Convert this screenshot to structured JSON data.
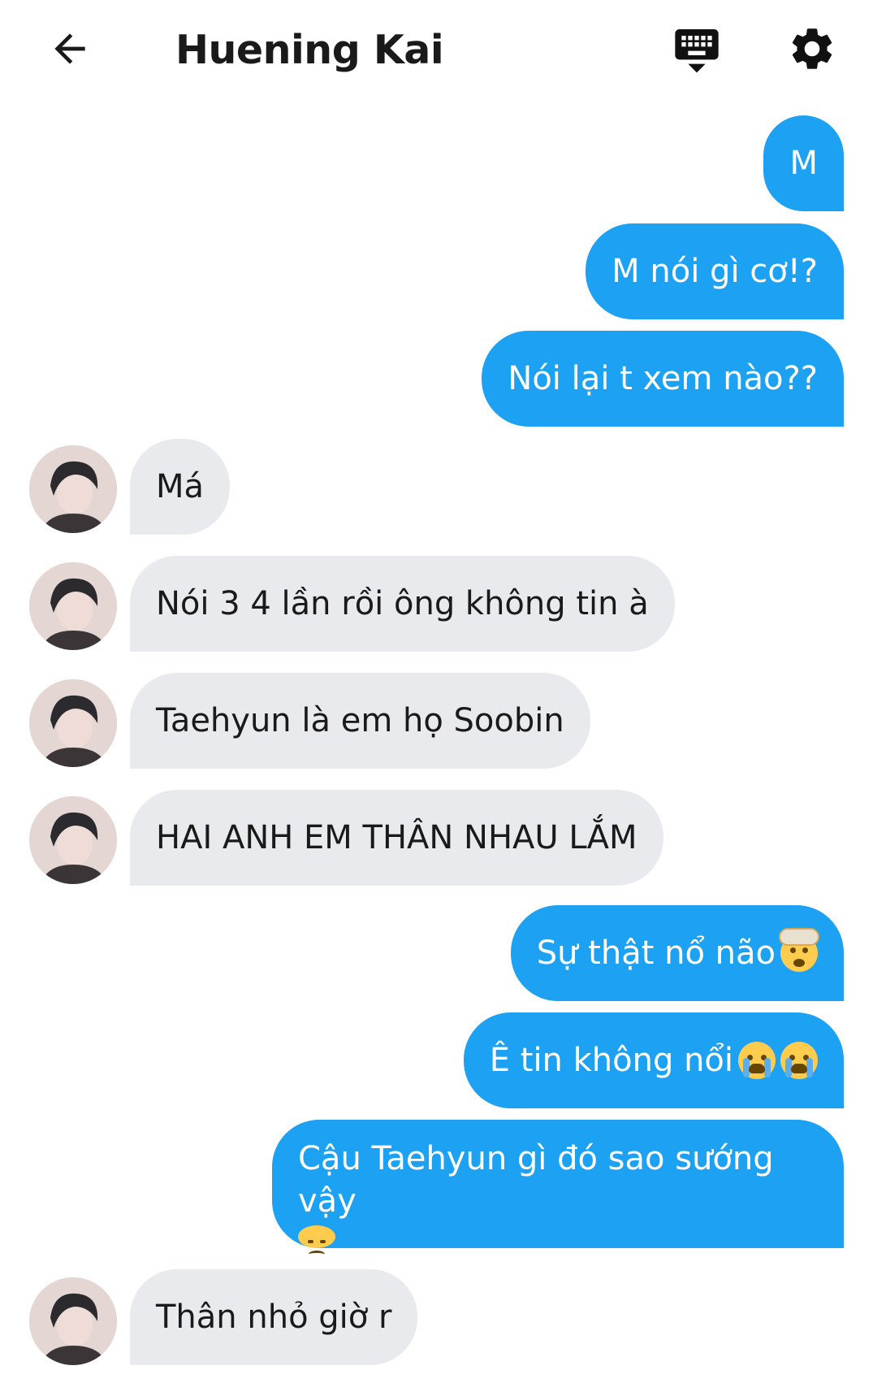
{
  "header": {
    "title": "Huening Kai",
    "back_icon": "arrow-left-icon",
    "keyboard_icon": "keyboard-hide-icon",
    "settings_icon": "gear-icon"
  },
  "colors": {
    "outgoing_bubble": "#1da1f2",
    "incoming_bubble": "#e8eaed"
  },
  "messages": [
    {
      "dir": "out",
      "text": "M"
    },
    {
      "dir": "out",
      "text": "M nói gì cơ!?"
    },
    {
      "dir": "out",
      "text": "Nói lại t xem nào??"
    },
    {
      "dir": "in",
      "text": "Má"
    },
    {
      "dir": "in",
      "text": "Nói 3 4 lần rồi ông không tin à"
    },
    {
      "dir": "in",
      "text": "Taehyun là em họ Soobin"
    },
    {
      "dir": "in",
      "text": "HAI ANH EM THÂN NHAU LẮM"
    },
    {
      "dir": "out",
      "text": "Sự thật nổ não",
      "emoji": [
        "exploding-head-emoji"
      ]
    },
    {
      "dir": "out",
      "text": "Ê tin không nổi",
      "emoji": [
        "loudly-crying-emoji",
        "loudly-crying-emoji"
      ]
    },
    {
      "dir": "out",
      "text": "Cậu Taehyun gì đó sao sướng vậy",
      "emoji": [
        "disappointed-face-emoji"
      ]
    },
    {
      "dir": "in",
      "text": "Thân nhỏ giờ r"
    }
  ]
}
